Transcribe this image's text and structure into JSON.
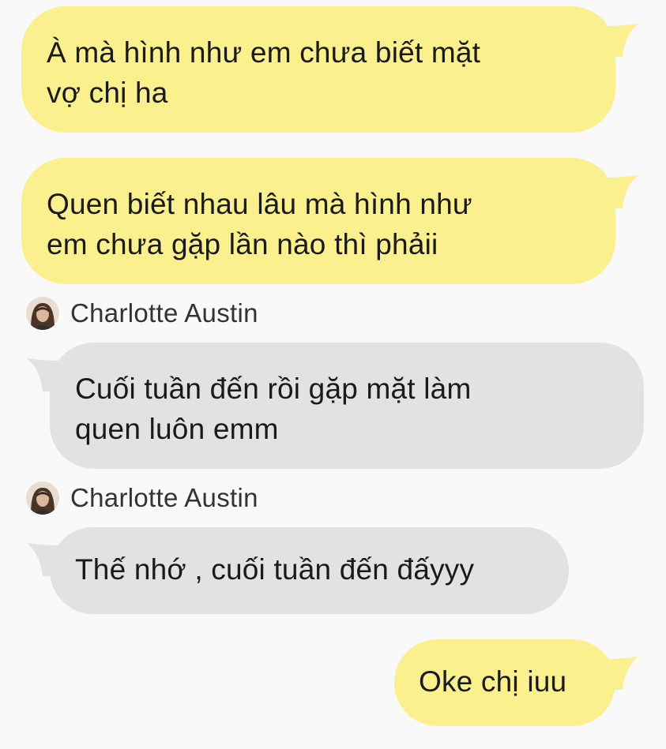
{
  "colors": {
    "outgoing_bubble": "#fbf08e",
    "incoming_bubble": "#e2e2e2",
    "background": "#f9f9f9",
    "text": "#1a1a1a"
  },
  "messages": [
    {
      "direction": "outgoing",
      "lines": [
        "À mà hình như em chưa biết mặt",
        "vợ chị ha"
      ]
    },
    {
      "direction": "outgoing",
      "lines": [
        "Quen biết nhau lâu mà hình như",
        "em chưa gặp lần nào thì phảii"
      ]
    },
    {
      "direction": "incoming",
      "sender": "Charlotte Austin",
      "lines": [
        "Cuối tuần đến rồi gặp mặt làm",
        "quen luôn emm"
      ]
    },
    {
      "direction": "incoming",
      "sender": "Charlotte Austin",
      "lines": [
        "Thế nhớ , cuối tuần đến đấyyy"
      ]
    },
    {
      "direction": "outgoing",
      "lines": [
        "Oke chị iuu"
      ]
    }
  ]
}
